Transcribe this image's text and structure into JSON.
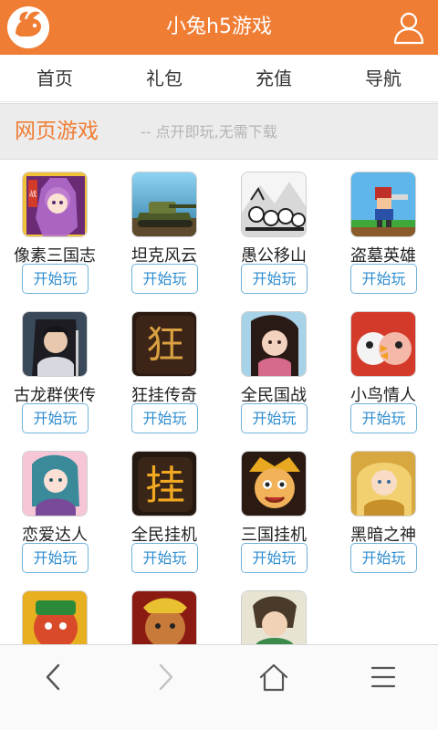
{
  "header": {
    "title": "小兔h5游戏",
    "brand_color": "#f07d34"
  },
  "nav": {
    "items": [
      {
        "label": "首页"
      },
      {
        "label": "礼包"
      },
      {
        "label": "充值"
      },
      {
        "label": "导航"
      }
    ]
  },
  "section": {
    "title": "网页游戏",
    "subtitle": "-- 点开即玩,无需下载"
  },
  "games": [
    {
      "name": "像素三国志",
      "button": "开始玩",
      "icon": "pixel-three-kingdoms-icon"
    },
    {
      "name": "坦克风云",
      "button": "开始玩",
      "icon": "tank-icon"
    },
    {
      "name": "愚公移山",
      "button": "开始玩",
      "icon": "yugong-icon"
    },
    {
      "name": "盗墓英雄",
      "button": "开始玩",
      "icon": "tomb-hero-icon"
    },
    {
      "name": "古龙群侠传",
      "button": "开始玩",
      "icon": "swordsman-icon"
    },
    {
      "name": "狂挂传奇",
      "button": "开始玩",
      "icon": "kuang-character-icon"
    },
    {
      "name": "全民国战",
      "button": "开始玩",
      "icon": "national-war-icon"
    },
    {
      "name": "小鸟情人",
      "button": "开始玩",
      "icon": "bird-lovers-icon"
    },
    {
      "name": "恋爱达人",
      "button": "开始玩",
      "icon": "love-expert-icon"
    },
    {
      "name": "全民挂机",
      "button": "开始玩",
      "icon": "gua-character-icon"
    },
    {
      "name": "三国挂机",
      "button": "开始玩",
      "icon": "three-kingdoms-idle-icon"
    },
    {
      "name": "黑暗之神",
      "button": "开始玩",
      "icon": "dark-god-icon"
    },
    {
      "name": "",
      "button": "",
      "icon": "red-warrior-icon"
    },
    {
      "name": "",
      "button": "",
      "icon": "monkey-king-icon"
    },
    {
      "name": "",
      "button": "",
      "icon": "green-hero-icon"
    }
  ],
  "bottombar": {
    "back": "chevron-left-icon",
    "forward": "chevron-right-icon",
    "home": "home-icon",
    "menu": "menu-icon"
  }
}
